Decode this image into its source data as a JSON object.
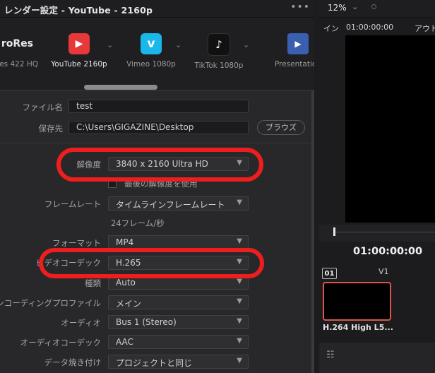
{
  "window": {
    "title": "レンダー設定 - YouTube - 2160p",
    "menu_glyph": "•••"
  },
  "presets": [
    {
      "label": "es 422 HQ",
      "top_text": "roRes",
      "icon": "prores-icon",
      "color": ""
    },
    {
      "label": "YouTube 2160p",
      "icon": "youtube-icon",
      "color": "#e7383a",
      "glyph": "▶"
    },
    {
      "label": "Vimeo 1080p",
      "icon": "vimeo-icon",
      "color": "#1ab7ea",
      "glyph": "v"
    },
    {
      "label": "TikTok 1080p",
      "icon": "tiktok-icon",
      "color": "#111111",
      "glyph": "♪"
    },
    {
      "label": "Presentation",
      "icon": "presentation-icon",
      "color": "#3a5fb0",
      "glyph": "▶"
    }
  ],
  "form": {
    "filename_label": "ファイル名",
    "filename_value": "test",
    "location_label": "保存先",
    "location_value": "C:\\Users\\GIGAZINE\\Desktop",
    "browse_label": "ブラウズ",
    "resolution_label": "解像度",
    "resolution_value": "3840 x 2160 Ultra HD",
    "max_res_label": "最後の解像度を使用",
    "framerate_label": "フレームレート",
    "framerate_value": "タイムラインフレームレート",
    "framerate_note": "24フレーム/秒",
    "format_label": "フォーマット",
    "format_value": "MP4",
    "codec_label": "ビデオコーデック",
    "codec_value": "H.265",
    "type_label": "種類",
    "type_value": "Auto",
    "profile_label": "エンコーディングプロファイル",
    "profile_value": "メイン",
    "audio_label": "オーディオ",
    "audio_value": "Bus 1 (Stereo)",
    "audio_codec_label": "オーディオコーデック",
    "audio_codec_value": "AAC",
    "burnin_label": "データ焼き付け",
    "burnin_value": "プロジェクトと同じ"
  },
  "viewer": {
    "zoom": "12%",
    "in_label": "イン",
    "in_tc": "01:00:00:00",
    "out_label": "アウト",
    "timecode": "01:00:00:00"
  },
  "clip": {
    "index": "01",
    "track": "V1",
    "label": "H.264 High L5..."
  },
  "colors": {
    "highlight": "#ee1e1e",
    "clip_border": "#e0554a"
  }
}
